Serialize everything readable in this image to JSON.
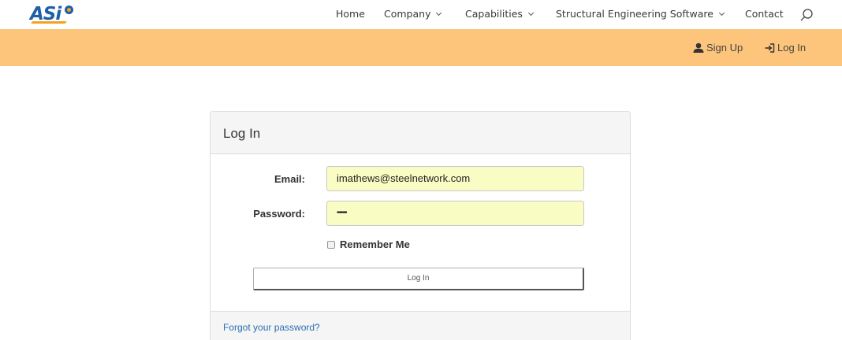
{
  "logo": {
    "text": "ASi",
    "brand_color": "#1f5fa8",
    "accent_color": "#f4a21d"
  },
  "nav": {
    "items": [
      {
        "label": "Home",
        "has_dropdown": false
      },
      {
        "label": "Company",
        "has_dropdown": true
      },
      {
        "label": "Capabilities",
        "has_dropdown": true
      },
      {
        "label": "Structural Engineering Software",
        "has_dropdown": true
      },
      {
        "label": "Contact",
        "has_dropdown": false
      }
    ],
    "search_icon": "search-icon"
  },
  "account_bar": {
    "color": "#fcc57b",
    "sign_up": {
      "label": "Sign Up",
      "icon": "user-icon"
    },
    "log_in": {
      "label": "Log In",
      "icon": "login-icon"
    }
  },
  "login_panel": {
    "title": "Log In",
    "email": {
      "label": "Email:",
      "value": "imathews@steelnetwork.com"
    },
    "password": {
      "label": "Password:",
      "value": "•••••"
    },
    "remember_me": {
      "label": "Remember Me",
      "checked": false
    },
    "submit_label": "Log In",
    "forgot_link": "Forgot your password?",
    "autofill_color": "#fafdc3",
    "link_color": "#2a6eb2"
  }
}
